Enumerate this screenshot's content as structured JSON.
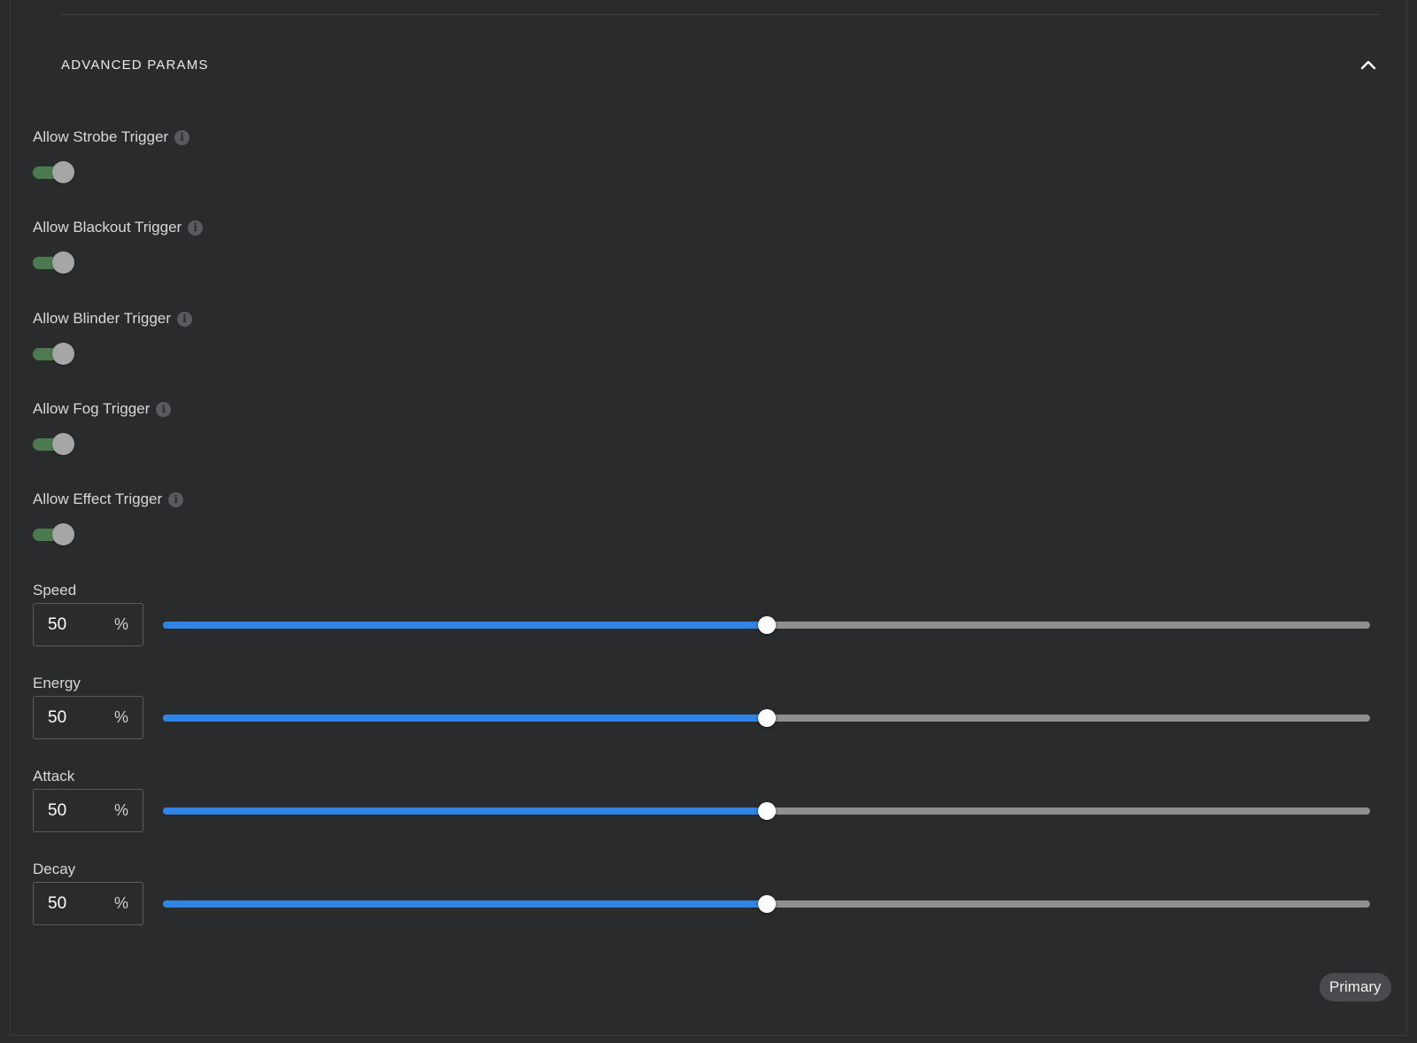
{
  "section": {
    "title": "ADVANCED PARAMS",
    "collapse_icon": "chevron-up-icon"
  },
  "toggles": [
    {
      "label": "Allow Strobe Trigger",
      "on": true
    },
    {
      "label": "Allow Blackout Trigger",
      "on": true
    },
    {
      "label": "Allow Blinder Trigger",
      "on": true
    },
    {
      "label": "Allow Fog Trigger",
      "on": true
    },
    {
      "label": "Allow Effect Trigger",
      "on": true
    }
  ],
  "info_icon_glyph": "i",
  "sliders": [
    {
      "label": "Speed",
      "value": "50",
      "unit": "%",
      "percent": 50
    },
    {
      "label": "Energy",
      "value": "50",
      "unit": "%",
      "percent": 50
    },
    {
      "label": "Attack",
      "value": "50",
      "unit": "%",
      "percent": 50
    },
    {
      "label": "Decay",
      "value": "50",
      "unit": "%",
      "percent": 50
    }
  ],
  "chip": {
    "label": "Primary"
  },
  "colors": {
    "background": "#2a2b2d",
    "toggle_on_track": "#4c7a4f",
    "slider_fill": "#2f84e6",
    "slider_track": "#8f8f8f"
  }
}
